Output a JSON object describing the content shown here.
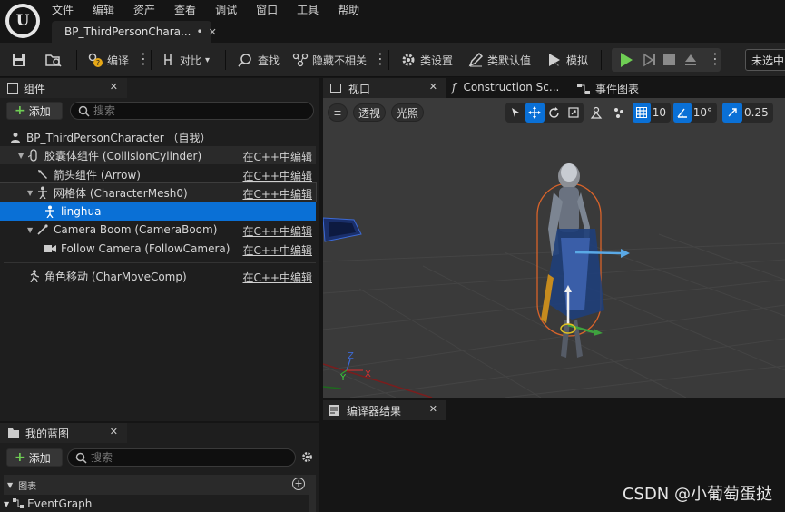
{
  "menu": [
    "文件",
    "编辑",
    "资产",
    "查看",
    "调试",
    "窗口",
    "工具",
    "帮助"
  ],
  "asset_tab": {
    "title": "BP_ThirdPersonChara...",
    "modified": "•",
    "close": "✕"
  },
  "toolbar": {
    "compile": "编译",
    "diff": "对比",
    "find": "查找",
    "hide_unrelated": "隐藏不相关",
    "class_settings": "类设置",
    "class_defaults": "类默认值",
    "simulate": "模拟",
    "debug_object": "未选中"
  },
  "components": {
    "tab_title": "组件",
    "add_label": "添加",
    "search_placeholder": "搜索",
    "root": "BP_ThirdPersonCharacter （自我）",
    "rows": [
      {
        "label": "胶囊体组件 (CollisionCylinder)",
        "edit": "在C++中编辑"
      },
      {
        "label": "箭头组件 (Arrow)",
        "edit": "在C++中编辑"
      },
      {
        "label": "网格体 (CharacterMesh0)",
        "edit": "在C++中编辑"
      },
      {
        "label": "linghua",
        "edit": ""
      },
      {
        "label": "Camera Boom (CameraBoom)",
        "edit": "在C++中编辑"
      },
      {
        "label": "Follow Camera (FollowCamera)",
        "edit": "在C++中编辑"
      },
      {
        "label": "角色移动 (CharMoveComp)",
        "edit": "在C++中编辑"
      }
    ]
  },
  "viewport_tabs": {
    "viewport": "视口",
    "construction": "Construction Sc...",
    "event_graph": "事件图表"
  },
  "viewport": {
    "perspective": "透视",
    "lit": "光照",
    "grid_snap": "10",
    "rotation_snap": "10°",
    "scale_snap": "0.25",
    "axis_z": "Z",
    "axis_y": "Y",
    "axis_x": "X"
  },
  "compiler": {
    "tab": "编译器结果"
  },
  "watermark": "CSDN @小葡萄蛋挞",
  "my_blueprint": {
    "tab_title": "我的蓝图",
    "add_label": "添加",
    "search_placeholder": "搜索",
    "section": "图表",
    "event_graph": "EventGraph"
  },
  "colors": {
    "accent": "#0a70d6",
    "play": "#6fce54",
    "bg": "#151515",
    "panel": "#1e1e1e"
  }
}
